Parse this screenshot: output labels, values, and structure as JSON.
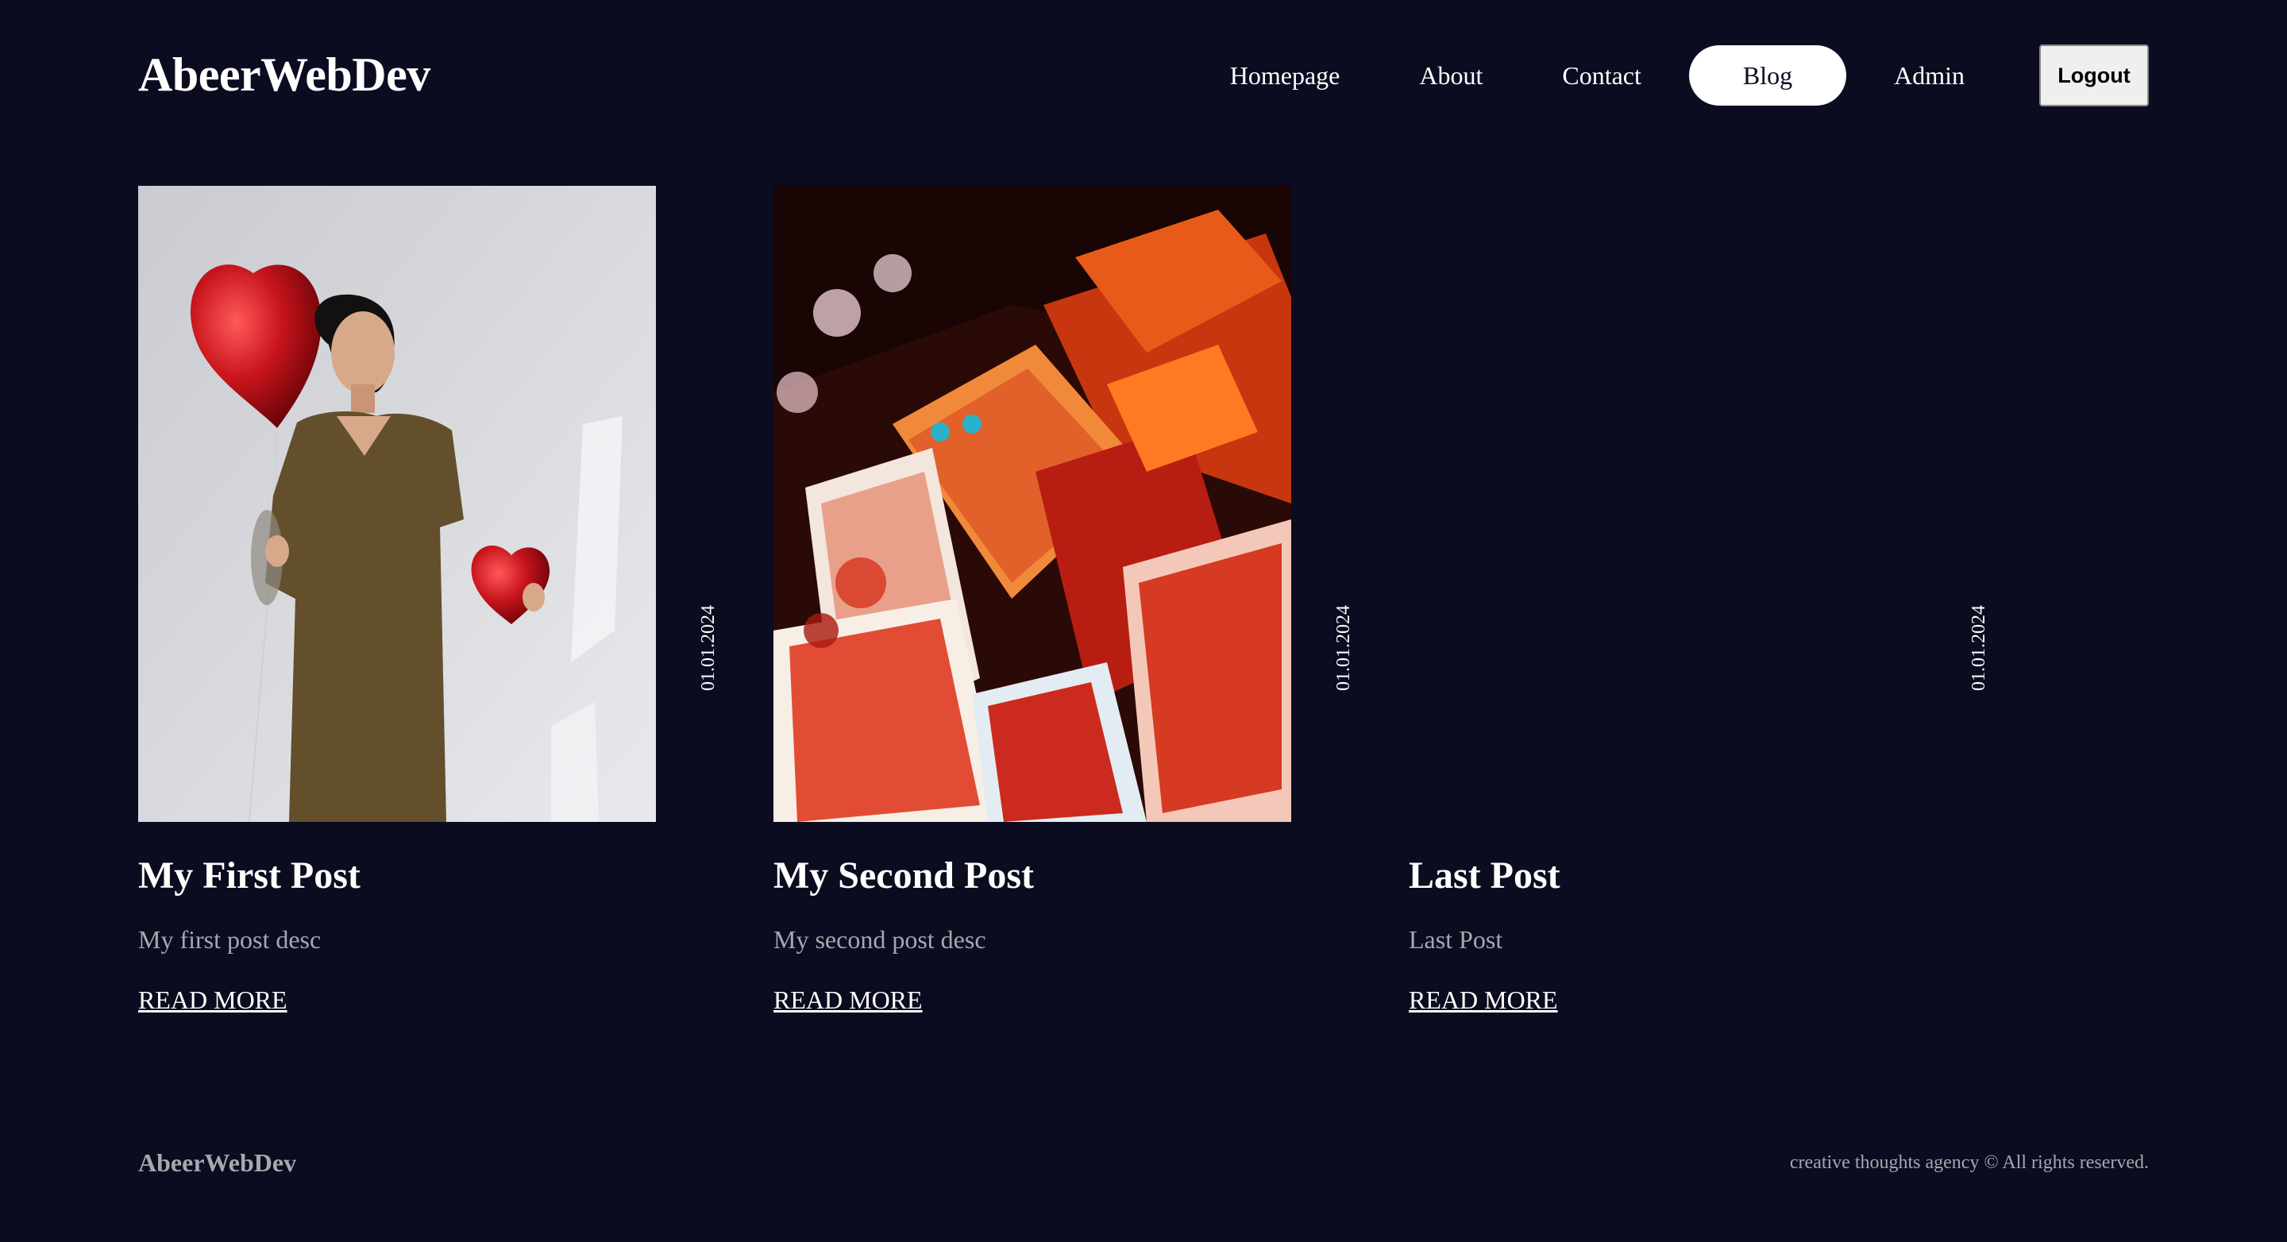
{
  "brand": "AbeerWebDev",
  "nav": {
    "homepage": "Homepage",
    "about": "About",
    "contact": "Contact",
    "blog": "Blog",
    "admin": "Admin",
    "logout": "Logout"
  },
  "posts": [
    {
      "title": "My First Post",
      "desc": "My first post desc",
      "date": "01.01.2024",
      "link": "READ MORE"
    },
    {
      "title": "My Second Post",
      "desc": "My second post desc",
      "date": "01.01.2024",
      "link": "READ MORE"
    },
    {
      "title": "Last Post",
      "desc": "Last Post",
      "date": "01.01.2024",
      "link": "READ MORE"
    }
  ],
  "footer": {
    "brand": "AbeerWebDev",
    "copyright": "creative thoughts agency © All rights reserved."
  },
  "colors": {
    "background": "#0b0c1f",
    "text": "#ffffff",
    "muted": "#a7a7ad"
  }
}
